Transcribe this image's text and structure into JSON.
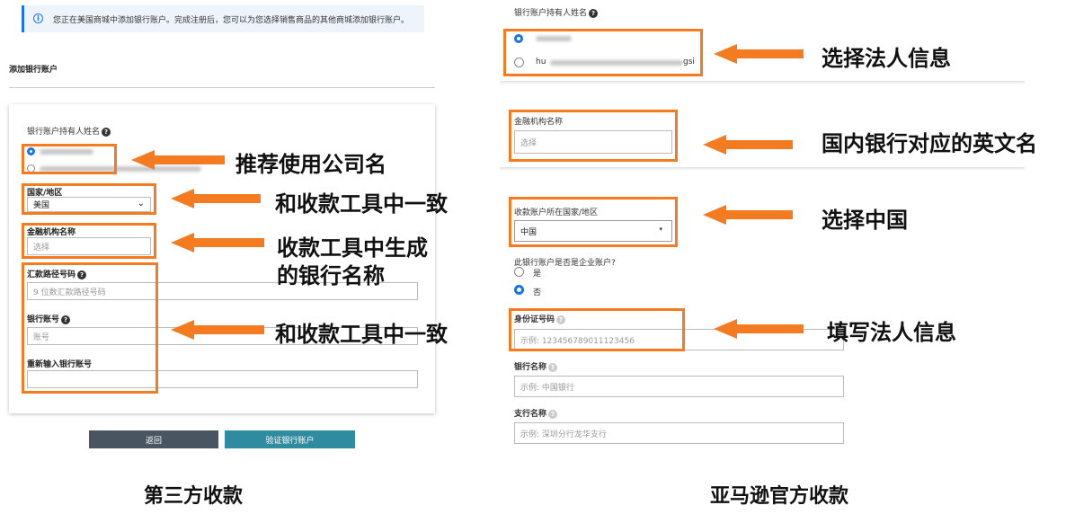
{
  "left": {
    "notice": "您正在美国商城中添加银行账户。完成注册后，您可以为您选择销售商品的其他商城添加银行账户。",
    "section_title": "添加银行账户",
    "holder_label": "银行账户持有人姓名",
    "country_label": "国家/地区",
    "country_value": "美国",
    "institution_label": "金融机构名称",
    "institution_placeholder": "选择",
    "routing_label": "汇款路径号码",
    "routing_placeholder": "9 位数汇款路径号码",
    "account_label": "银行账号",
    "account_placeholder": "账号",
    "reenter_label": "重新输入银行账号",
    "back_button": "返回",
    "verify_button": "验证银行账户",
    "caption": "第三方收款"
  },
  "right": {
    "holder_label": "银行账户持有人姓名",
    "holder_option2_suffix": "hu",
    "holder_option2_end": "gsi",
    "institution_label": "金融机构名称",
    "institution_placeholder": "选择",
    "country_label": "收款账户所在国家/地区",
    "country_value": "中国",
    "business_question": "此银行账户是否是企业账户?",
    "yes": "是",
    "no": "否",
    "id_label": "身份证号码",
    "id_placeholder": "示例: 123456789011123456",
    "bank_name_label": "银行名称",
    "bank_name_placeholder": "示例: 中国银行",
    "branch_label": "支行名称",
    "branch_placeholder": "示例: 深圳分行龙华支行",
    "caption": "亚马逊官方收款"
  },
  "annotations": {
    "a1": "推荐使用公司名",
    "a2": "和收款工具中一致",
    "a3_line1": "收款工具中生成",
    "a3_line2": "的银行名称",
    "a4": "和收款工具中一致",
    "b1": "选择法人信息",
    "b2": "国内银行对应的英文名",
    "b3": "选择中国",
    "b4": "填写法人信息"
  },
  "colors": {
    "annotation_orange": "#f47b20",
    "back_button_bg": "#4a5562",
    "verify_button_bg": "#2f8ca0",
    "notice_border": "#1a73e8"
  }
}
